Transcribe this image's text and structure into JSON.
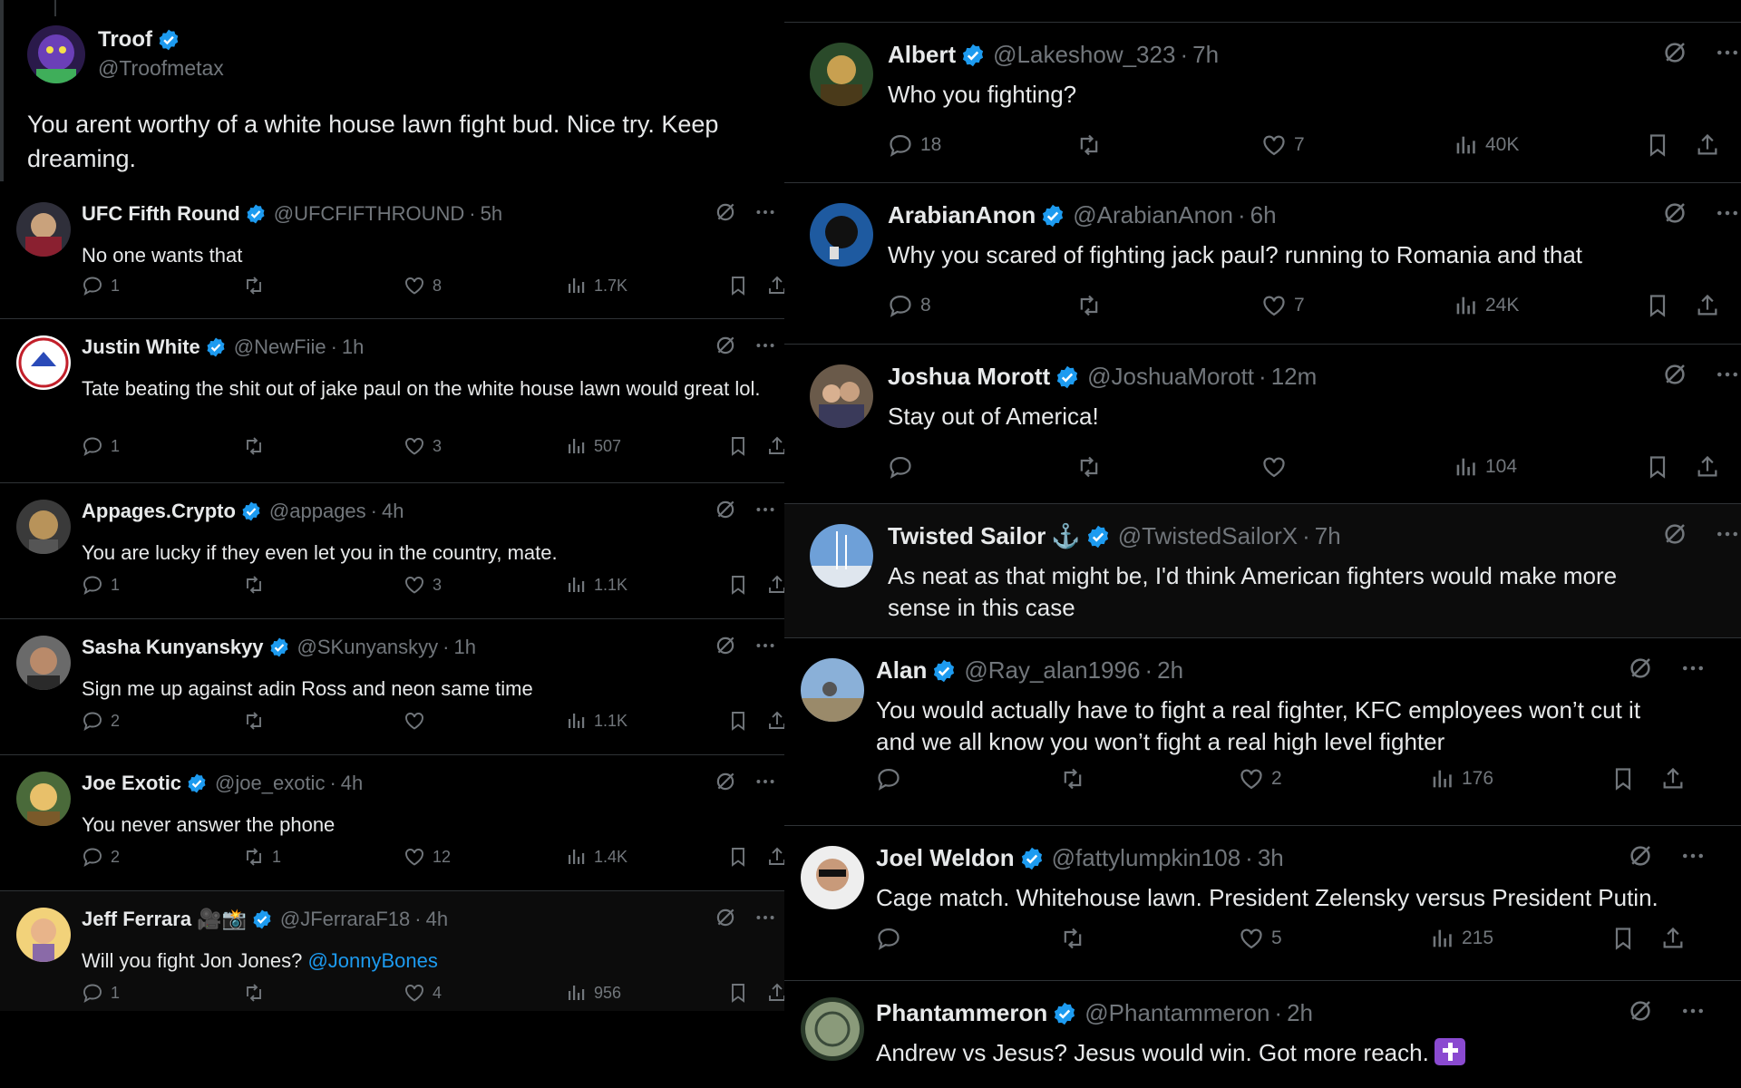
{
  "colors": {
    "background": "#000000",
    "text": "#e7e9ea",
    "muted": "#71767b",
    "verified": "#1d9bf0",
    "link": "#1d9bf0",
    "divider": "#2f3336"
  },
  "main_post": {
    "name": "Troof",
    "handle": "@Troofmetax",
    "text": "You arent worthy of a white house lawn fight bud. Nice try. Keep dreaming."
  },
  "left_replies": [
    {
      "name": "UFC Fifth Round",
      "handle": "@UFCFIFTHROUND",
      "time": "5h",
      "text": "No one wants that",
      "replies": "1",
      "reposts": "",
      "likes": "8",
      "views": "1.7K"
    },
    {
      "name": "Justin White",
      "handle": "@NewFiie",
      "time": "1h",
      "text": "Tate beating the shit out of jake paul on the white house lawn would great lol.",
      "replies": "1",
      "reposts": "",
      "likes": "3",
      "views": "507"
    },
    {
      "name": "Appages.Crypto",
      "handle": "@appages",
      "time": "4h",
      "text": "You are lucky if they even let you in the country, mate.",
      "replies": "1",
      "reposts": "",
      "likes": "3",
      "views": "1.1K"
    },
    {
      "name": "Sasha Kunyanskyy",
      "handle": "@SKunyanskyy",
      "time": "1h",
      "text": "Sign me up against adin Ross and neon same time",
      "replies": "2",
      "reposts": "",
      "likes": "",
      "views": "1.1K"
    },
    {
      "name": "Joe Exotic",
      "handle": "@joe_exotic",
      "time": "4h",
      "text": "You never answer the phone",
      "replies": "2",
      "reposts": "1",
      "likes": "12",
      "views": "1.4K"
    },
    {
      "name": "Jeff Ferrara",
      "name_extra": "🎥📸",
      "handle": "@JFerraraF18",
      "time": "4h",
      "text": "Will you fight Jon Jones?",
      "link": "@JonnyBones",
      "replies": "1",
      "reposts": "",
      "likes": "4",
      "views": "956"
    }
  ],
  "right_replies": [
    {
      "name": "Albert",
      "handle": "@Lakeshow_323",
      "time": "7h",
      "text": "Who you fighting?",
      "replies": "18",
      "reposts": "",
      "likes": "7",
      "views": "40K"
    },
    {
      "name": "ArabianAnon",
      "handle": "@ArabianAnon",
      "time": "6h",
      "text": "Why you scared of fighting jack paul? running to Romania and that",
      "replies": "8",
      "reposts": "",
      "likes": "7",
      "views": "24K"
    },
    {
      "name": "Joshua Morott",
      "handle": "@JoshuaMorott",
      "time": "12m",
      "text": "Stay out of America!",
      "replies": "",
      "reposts": "",
      "likes": "",
      "views": "104"
    },
    {
      "name": "Twisted Sailor",
      "name_extra": "⚓",
      "handle": "@TwistedSailorX",
      "time": "7h",
      "text": "As neat as that might be, I'd think American fighters would make more sense in this case"
    },
    {
      "name": "Alan",
      "handle": "@Ray_alan1996",
      "time": "2h",
      "text": "You would actually have to fight a real fighter, KFC employees won’t cut it and we all know you won’t fight a real high level fighter",
      "replies": "",
      "reposts": "",
      "likes": "2",
      "views": "176"
    },
    {
      "name": "Joel Weldon",
      "handle": "@fattylumpkin108",
      "time": "3h",
      "text": "Cage match. Whitehouse lawn. President Zelensky versus President Putin.",
      "replies": "",
      "reposts": "",
      "likes": "5",
      "views": "215"
    },
    {
      "name": "Phantammeron",
      "handle": "@Phantammeron",
      "time": "2h",
      "text": "Andrew vs Jesus? Jesus would win. Got more reach."
    }
  ],
  "icons": [
    "verified-badge-icon",
    "grok-icon",
    "more-icon",
    "reply-icon",
    "repost-icon",
    "like-icon",
    "views-icon",
    "bookmark-icon",
    "share-icon",
    "anchor-icon",
    "cross-icon"
  ]
}
